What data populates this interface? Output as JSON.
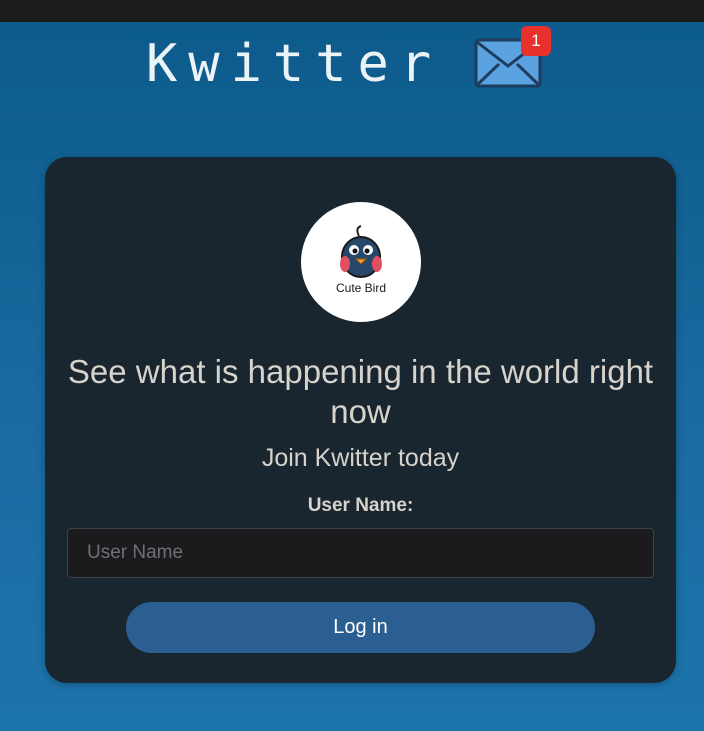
{
  "header": {
    "title": "Kwitter",
    "notification_icon": "mail-icon",
    "notification_count": "1",
    "badge_color": "#e8302d"
  },
  "card": {
    "logo": {
      "icon": "bird-icon",
      "text": "Cute Bird"
    },
    "headline": "See what is happening in the world right now",
    "subheadline": "Join Kwitter today",
    "username_label": "User Name:",
    "username_input": {
      "value": "",
      "placeholder": "User Name"
    },
    "login_button_label": "Log in"
  },
  "colors": {
    "background": "#1569a0",
    "card": "#19262f",
    "button": "#2b5f92",
    "text": "#d6d2cc"
  }
}
